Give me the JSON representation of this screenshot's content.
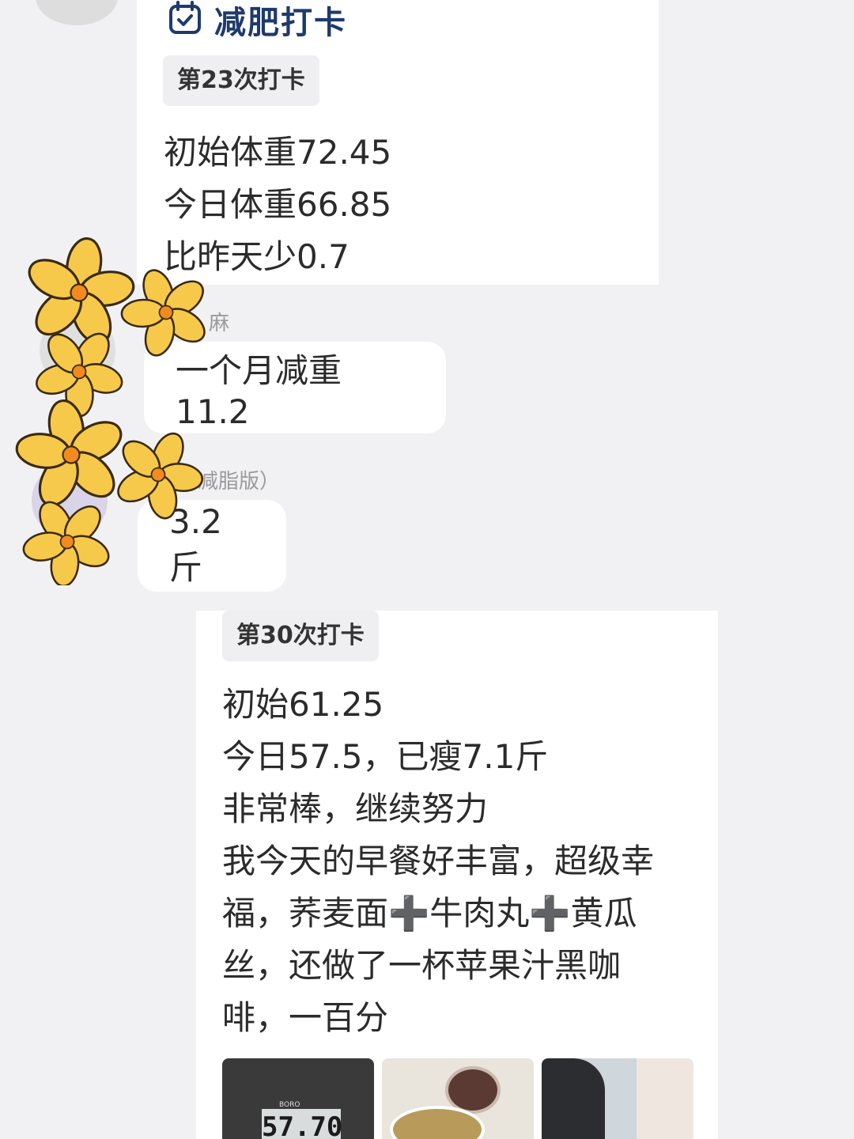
{
  "checkin_card_1": {
    "title": "减肥打卡",
    "tag": "第23次打卡",
    "lines": [
      "初始体重72.45",
      "今日体重66.85",
      "比昨天少0.7"
    ]
  },
  "reply_1": {
    "name_fragment": "麻",
    "text": "一个月减重11.2"
  },
  "reply_2": {
    "name_fragment": "减脂版）",
    "text": "3.2斤"
  },
  "checkin_card_2": {
    "tag": "第30次打卡",
    "lines": [
      "初始61.25",
      "今日57.5，已瘦7.1斤",
      "非常棒，继续努力",
      "我今天的早餐好丰富，超级幸",
      "福，荞麦面➕牛肉丸➕黄瓜",
      "丝，还做了一杯苹果汁黑咖",
      "啡，一百分"
    ],
    "photos": {
      "scale_brand": "BORO",
      "scale_reading": "57.70"
    }
  },
  "colors": {
    "background": "#f1f1f3",
    "card": "#ffffff",
    "title_accent": "#1e3a6e",
    "tag_bg": "#efeff1",
    "flower": "#f6c94a"
  },
  "icons": [
    "calendar-check-icon",
    "flower-sticker"
  ]
}
